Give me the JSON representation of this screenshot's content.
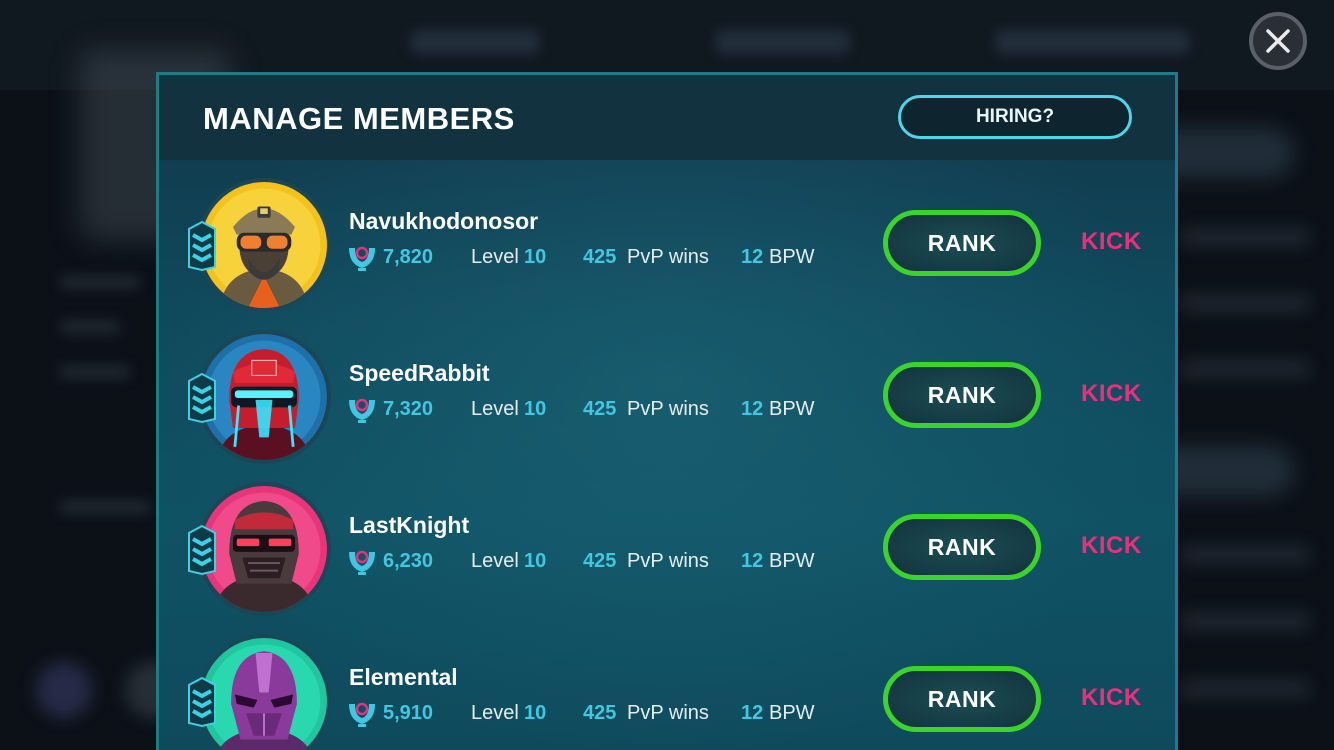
{
  "modal": {
    "title": "MANAGE MEMBERS",
    "hiring_label": "HIRING?"
  },
  "members": [
    {
      "name": "Navukhodonosor",
      "trophies": "7,820",
      "level_label": "Level",
      "level": "10",
      "pvp_wins": "425",
      "pvp_label": "PvP wins",
      "bpw": "12",
      "bpw_label": "BPW",
      "rank_label": "RANK",
      "kick_label": "KICK",
      "avatar": "soldier-goggles-avatar",
      "avatar_bg": "#f4c21c"
    },
    {
      "name": "SpeedRabbit",
      "trophies": "7,320",
      "level_label": "Level",
      "level": "10",
      "pvp_wins": "425",
      "pvp_label": "PvP wins",
      "bpw": "12",
      "bpw_label": "BPW",
      "rank_label": "RANK",
      "kick_label": "KICK",
      "avatar": "neon-helmet-avatar",
      "avatar_bg": "#1f6fa8"
    },
    {
      "name": "LastKnight",
      "trophies": "6,230",
      "level_label": "Level",
      "level": "10",
      "pvp_wins": "425",
      "pvp_label": "PvP wins",
      "bpw": "12",
      "bpw_label": "BPW",
      "rank_label": "RANK",
      "kick_label": "KICK",
      "avatar": "knight-helmet-avatar",
      "avatar_bg": "#e8357a"
    },
    {
      "name": "Elemental",
      "trophies": "5,910",
      "level_label": "Level",
      "level": "10",
      "pvp_wins": "425",
      "pvp_label": "PvP wins",
      "bpw": "12",
      "bpw_label": "BPW",
      "rank_label": "RANK",
      "kick_label": "KICK",
      "avatar": "purple-mask-avatar",
      "avatar_bg": "#1fc6a0"
    }
  ],
  "colors": {
    "accent_cyan": "#41c8e0",
    "rank_green": "#3bd42a",
    "kick_pink": "#ec2f7c",
    "hiring_border": "#4fd6e6"
  },
  "icons": {
    "close": "close-icon",
    "trophy": "trophy-icon",
    "rank_badge": "rank-chevrons-icon"
  }
}
